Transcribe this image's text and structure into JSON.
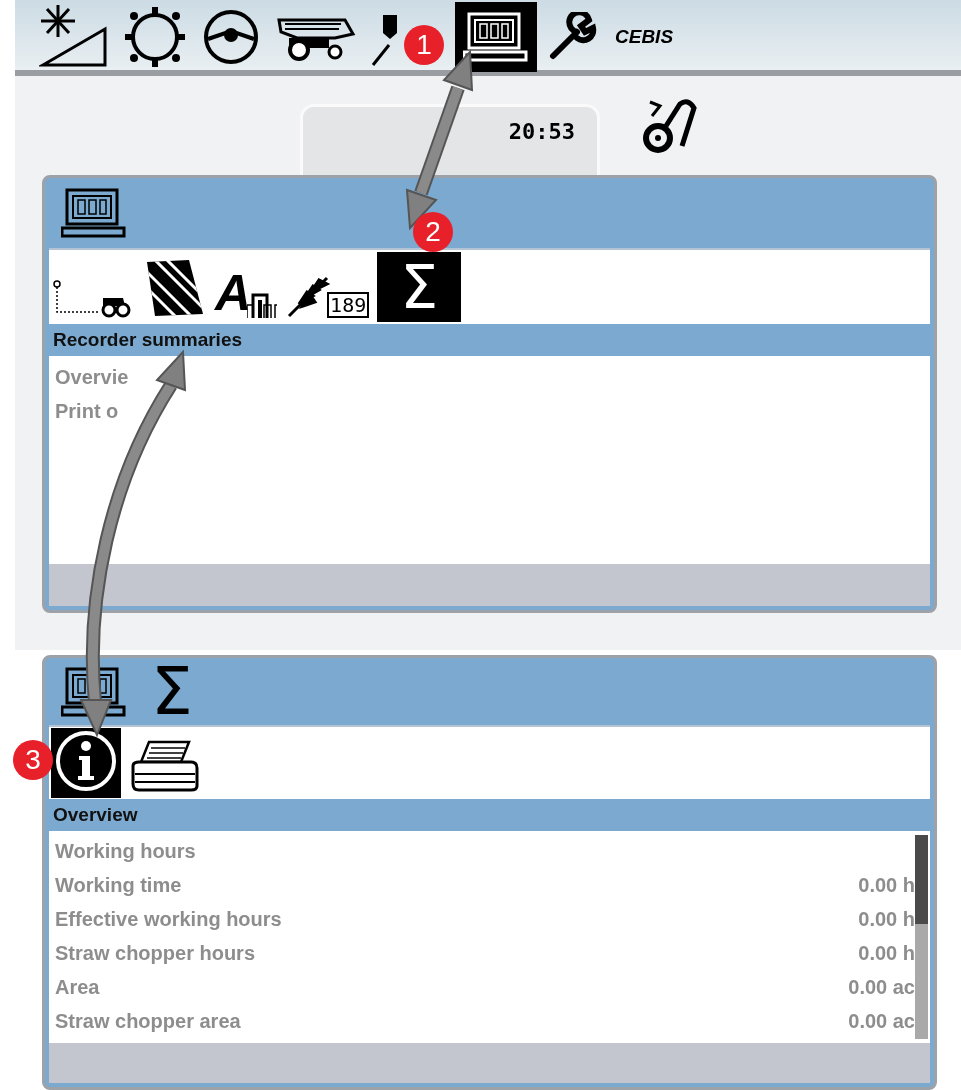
{
  "toolbar": {
    "items": [
      {
        "kind": "sun-slope",
        "selected": false
      },
      {
        "kind": "gear",
        "selected": false
      },
      {
        "kind": "steering-wheel",
        "selected": false
      },
      {
        "kind": "harvester",
        "selected": false
      },
      {
        "kind": "pin",
        "selected": false
      },
      {
        "kind": "recorder",
        "selected": true
      },
      {
        "kind": "wrench",
        "selected": false
      }
    ],
    "brand": "CEBIS"
  },
  "clock": "20:53",
  "panels": [
    {
      "header": [
        {
          "kind": "recorder"
        }
      ],
      "tabs": [
        {
          "kind": "route",
          "selected": false
        },
        {
          "kind": "field",
          "selected": false
        },
        {
          "kind": "letter",
          "label": "A",
          "selected": false
        },
        {
          "kind": "grain",
          "label": "189",
          "selected": false
        },
        {
          "kind": "sigma",
          "label": "Σ",
          "selected": true
        }
      ],
      "title": "Recorder summaries",
      "rows": [
        {
          "label": "Overvie"
        },
        {
          "label": "Print o"
        }
      ]
    },
    {
      "header": [
        {
          "kind": "recorder"
        },
        {
          "kind": "sigma",
          "label": "Σ"
        }
      ],
      "tabs": [
        {
          "kind": "info",
          "selected": true
        },
        {
          "kind": "printer",
          "selected": false
        }
      ],
      "title": "Overview",
      "rows": [
        {
          "label": "Working hours"
        },
        {
          "label": "Working time",
          "value": "0.00 h"
        },
        {
          "label": "Effective working hours",
          "value": "0.00 h"
        },
        {
          "label": "Straw chopper hours",
          "value": "0.00 h"
        },
        {
          "label": "Area",
          "value": "0.00 ac"
        },
        {
          "label": "Straw chopper area",
          "value": "0.00 ac"
        }
      ],
      "scrollbar": true
    }
  ],
  "callouts": [
    "1",
    "2",
    "3"
  ]
}
